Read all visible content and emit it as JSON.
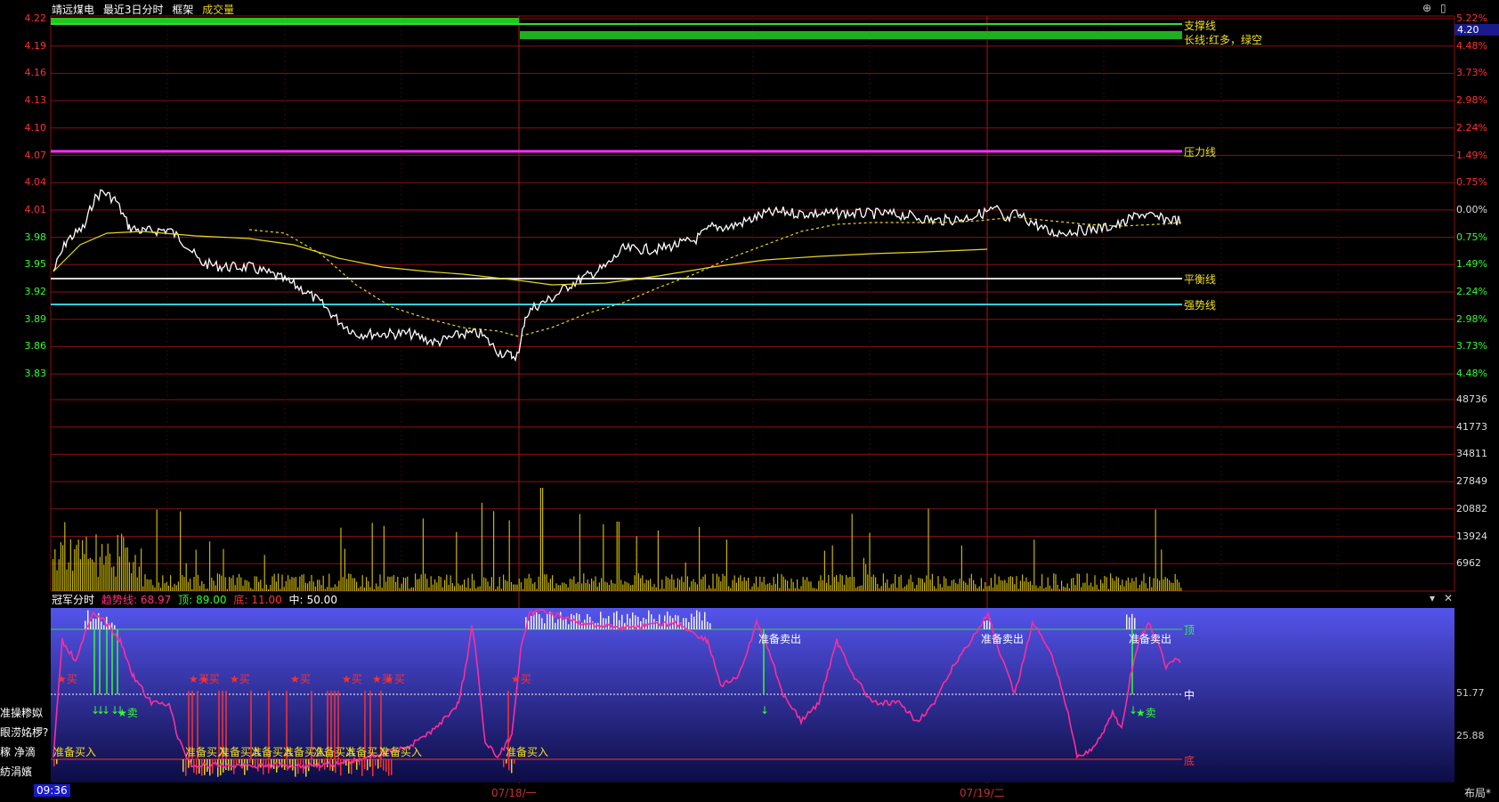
{
  "header": {
    "stock": "靖远煤电",
    "period": "最近3日分时",
    "mode": "框架",
    "indicator": "成交量"
  },
  "price_axis": [
    "4.22",
    "4.19",
    "4.16",
    "4.13",
    "4.10",
    "4.07",
    "4.04",
    "4.01",
    "3.98",
    "3.95",
    "3.92",
    "3.89",
    "3.86",
    "3.83"
  ],
  "pct_axis": [
    "5.22%",
    "4.48%",
    "3.73%",
    "2.98%",
    "2.24%",
    "1.49%",
    "0.75%",
    "0.00%",
    "0.75%",
    "1.49%",
    "2.24%",
    "2.98%",
    "3.73%",
    "4.48%"
  ],
  "current_price": "4.20",
  "volume_axis": [
    "48736",
    "41773",
    "34811",
    "27849",
    "20882",
    "13924",
    "6962"
  ],
  "line_labels": {
    "support": "支撑线",
    "long_line": "长线:红多，绿空",
    "pressure": "压力线",
    "balance": "平衡线",
    "strong": "强势线"
  },
  "sub_header": {
    "name": "冠军分时",
    "trend_label": "趋势线:",
    "trend_value": "68.97",
    "top_label": "顶:",
    "top_value": "89.00",
    "bottom_label": "底:",
    "bottom_value": "11.00",
    "mid_label": "中:",
    "mid_value": "50.00"
  },
  "sub_axis": [
    "51.77",
    "25.88"
  ],
  "sub_labels": {
    "top": "顶",
    "mid": "中",
    "bottom": "底",
    "prepare_buy": "准备买入",
    "prepare_sell": "准备卖出",
    "buy": "★买",
    "sell": "★卖"
  },
  "side_labels": [
    "准操糁姒",
    "眼涝姳椤?",
    "稼  净滴",
    "紡涓嬪"
  ],
  "bottom": {
    "time": "09:36",
    "date1": "07/18/一",
    "date2": "07/19/二",
    "layout": "布局*"
  },
  "colors": {
    "grid": "#8b1010",
    "price_text": "#ff3030",
    "green_text": "#30ff30",
    "volume": "#c8b400",
    "panel_top": "#5050e8",
    "panel_bottom": "#101050",
    "pressure": "#ff30ff",
    "strong": "#30d0e0"
  }
}
